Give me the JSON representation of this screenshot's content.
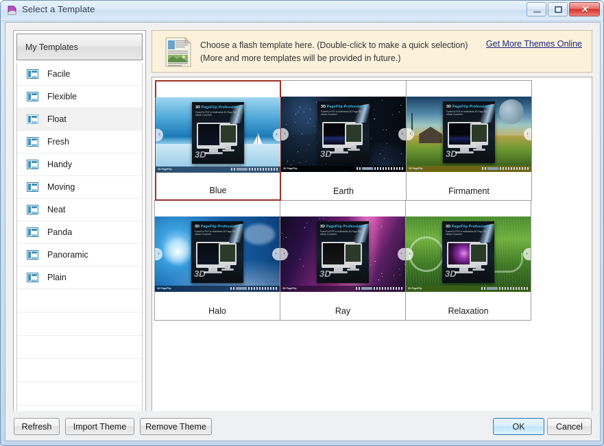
{
  "window": {
    "title": "Select a Template",
    "icon": "pageflip-app-icon",
    "controls": {
      "minimize": "minimize-icon",
      "restore": "restore-icon",
      "close": "close-icon"
    }
  },
  "sidebar": {
    "header": "My Templates",
    "items": [
      {
        "label": "Facile",
        "selected": false
      },
      {
        "label": "Flexible",
        "selected": false
      },
      {
        "label": "Float",
        "selected": true
      },
      {
        "label": "Fresh",
        "selected": false
      },
      {
        "label": "Handy",
        "selected": false
      },
      {
        "label": "Moving",
        "selected": false
      },
      {
        "label": "Neat",
        "selected": false
      },
      {
        "label": "Panda",
        "selected": false
      },
      {
        "label": "Panoramic",
        "selected": false
      },
      {
        "label": "Plain",
        "selected": false
      }
    ]
  },
  "banner": {
    "icon": "document-preview-icon",
    "line1": "Choose a flash template here. (Double-click to make a quick selection)",
    "line2": "(More and more templates will be provided in future.)",
    "link": "Get More Themes Online",
    "link_color": "#17257e",
    "background": "#fcf2dc"
  },
  "templates": {
    "selection_color": "#9d2f22",
    "cover_title_prefix": "3D",
    "cover_title_rest": "PageFlip Professional",
    "cover_subtitle": "PowerFul PDF to Multimedia 3D Page Flip eBook Converter",
    "brand": "3D PageFlip",
    "items": [
      {
        "name": "Blue",
        "selected": true
      },
      {
        "name": "Earth",
        "selected": false
      },
      {
        "name": "Firmament",
        "selected": false
      },
      {
        "name": "Halo",
        "selected": false
      },
      {
        "name": "Ray",
        "selected": false
      },
      {
        "name": "Relaxation",
        "selected": false
      }
    ]
  },
  "buttons": {
    "refresh": "Refresh",
    "import_theme": "Import Theme",
    "remove_theme": "Remove Theme",
    "ok": "OK",
    "cancel": "Cancel"
  }
}
